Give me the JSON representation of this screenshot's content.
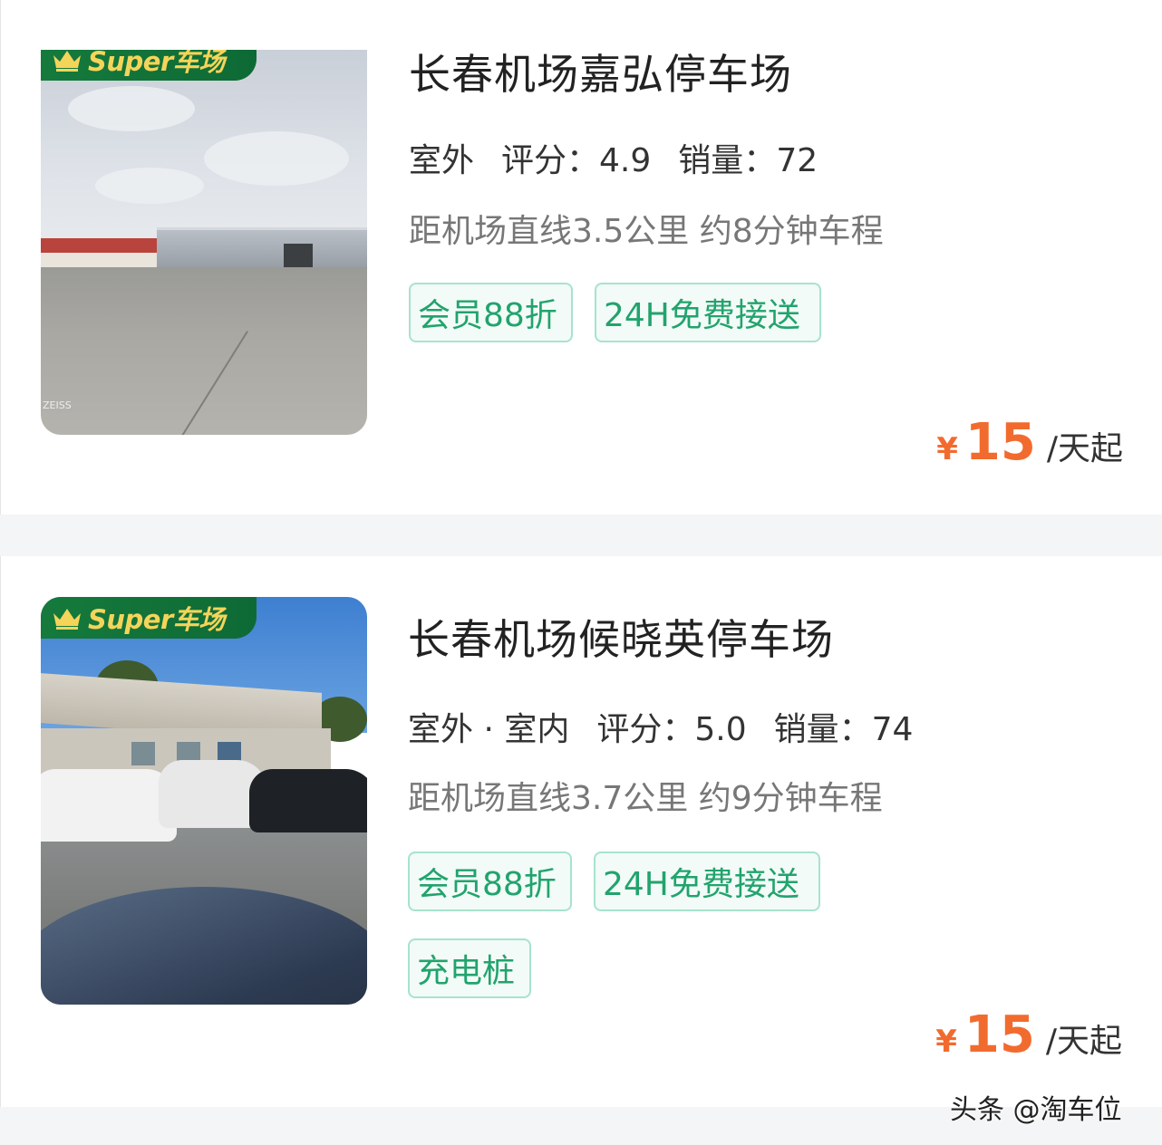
{
  "listings": [
    {
      "badge": "Super车场",
      "name": "长春机场嘉弘停车场",
      "type": "室外",
      "rating_label": "评分：",
      "rating": "4.9",
      "sales_label": "销量：",
      "sales": "72",
      "distance": "距机场直线3.5公里 约8分钟车程",
      "tags": [
        "会员88折",
        "24H免费接送"
      ],
      "price_symbol": "¥",
      "price": "15",
      "price_unit": "/天起",
      "photo_mark": "ZEISS"
    },
    {
      "badge": "Super车场",
      "name": "长春机场候晓英停车场",
      "type": "室外 · 室内",
      "rating_label": "评分：",
      "rating": "5.0",
      "sales_label": "销量：",
      "sales": "74",
      "distance": "距机场直线3.7公里 约9分钟车程",
      "tags": [
        "会员88折",
        "24H免费接送",
        "充电桩"
      ],
      "price_symbol": "¥",
      "price": "15",
      "price_unit": "/天起"
    }
  ],
  "watermark": "头条 @淘车位",
  "colors": {
    "accent": "#f26b2e",
    "tag_green": "#22a36d",
    "badge_green": "#157a3c",
    "badge_gold": "#f5d45a"
  }
}
